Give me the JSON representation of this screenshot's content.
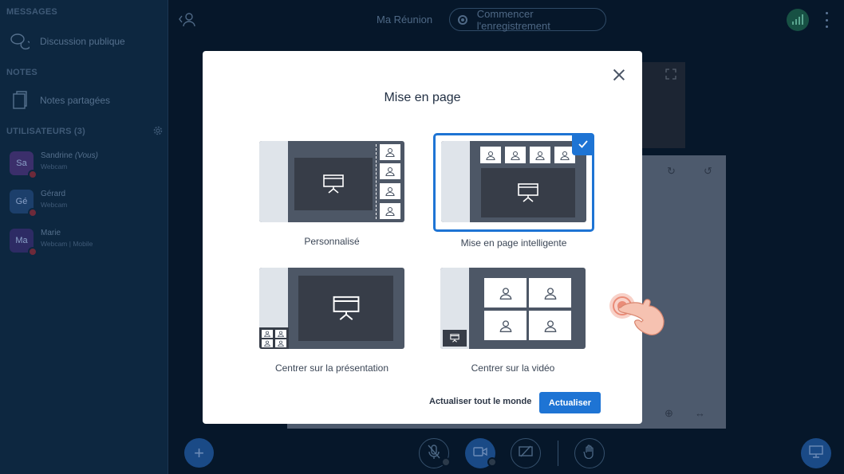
{
  "sidebar": {
    "messages_title": "MESSAGES",
    "public_chat": "Discussion publique",
    "notes_title": "NOTES",
    "shared_notes": "Notes partagées",
    "users_title": "UTILISATEURS (3)",
    "users": [
      {
        "initials": "Sa",
        "name": "Sandrine",
        "you": "(Vous)",
        "meta": "Webcam",
        "color": "#3b2f6b"
      },
      {
        "initials": "Gé",
        "name": "Gérard",
        "you": "",
        "meta": "Webcam",
        "color": "#1c3f6b"
      },
      {
        "initials": "Ma",
        "name": "Marie",
        "you": "",
        "meta": "Webcam | Mobile",
        "color": "#2d2b64"
      }
    ]
  },
  "header": {
    "meeting_name": "Ma Réunion",
    "record_label": "Commencer l'enregistrement"
  },
  "modal": {
    "title": "Mise en page",
    "options": [
      {
        "label": "Personnalisé",
        "selected": false
      },
      {
        "label": "Mise en page intelligente",
        "selected": true
      },
      {
        "label": "Centrer sur la présentation",
        "selected": false
      },
      {
        "label": "Centrer sur la vidéo",
        "selected": false
      }
    ],
    "update_all_label": "Actualiser tout le monde",
    "update_label": "Actualiser"
  },
  "colors": {
    "accent": "#1e74d4",
    "thumb_dark": "#4d5766",
    "thumb_light": "#dfe4ea",
    "sidebar_bg": "#0d2740"
  }
}
